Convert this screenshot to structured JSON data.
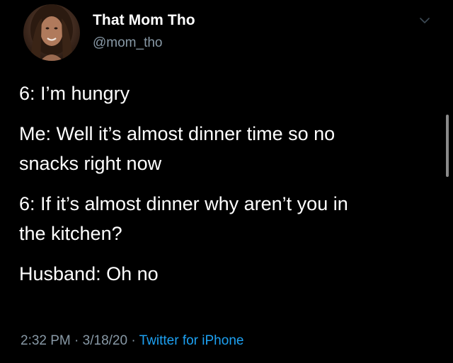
{
  "author": {
    "display_name": "That Mom Tho",
    "handle": "@mom_tho"
  },
  "tweet": {
    "lines": [
      "6: I’m hungry",
      "Me: Well it’s almost dinner time so no",
      "snacks right now",
      "6: If it’s almost dinner why aren’t you in",
      "the kitchen?",
      "Husband: Oh no"
    ]
  },
  "meta": {
    "time": "2:32 PM",
    "separator": "·",
    "date": "3/18/20",
    "source": "Twitter for iPhone"
  },
  "colors": {
    "background": "#000000",
    "text": "#ffffff",
    "secondary_text": "#8899a6",
    "link": "#1da1f2"
  },
  "icons": {
    "menu": "chevron-down-icon"
  }
}
